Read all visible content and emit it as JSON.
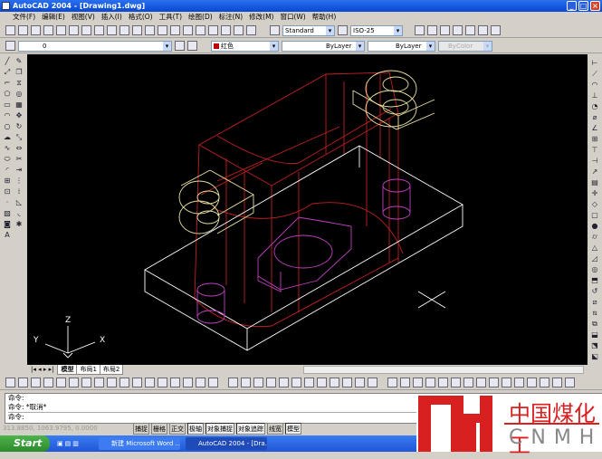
{
  "window": {
    "title": "AutoCAD 2004 - [Drawing1.dwg]"
  },
  "menu": [
    "文件(F)",
    "编辑(E)",
    "视图(V)",
    "插入(I)",
    "格式(O)",
    "工具(T)",
    "绘图(D)",
    "标注(N)",
    "修改(M)",
    "窗口(W)",
    "帮助(H)"
  ],
  "toolbar": {
    "text_style": "Standard",
    "dim_style": "ISO-25",
    "layer": "0",
    "color": "红色",
    "linetype": "ByLayer",
    "lineweight": "ByLayer",
    "plotstyle": "ByColor"
  },
  "colors": {
    "color_swatch": "#c00000",
    "plate": "#ffffff",
    "body": "#c02020",
    "bosses": "#e8e0a0",
    "holes": "#c040c0"
  },
  "ucs": {
    "z": "Z",
    "y": "Y",
    "x": "X"
  },
  "tabs": [
    "模型",
    "布局1",
    "布局2"
  ],
  "command": {
    "lines": [
      "命令:",
      "命令: *取消*",
      "命令:"
    ]
  },
  "status": {
    "coords": "313.8850, 1063.9795, 0.0000",
    "buttons": [
      {
        "label": "捕捉",
        "on": false
      },
      {
        "label": "栅格",
        "on": false
      },
      {
        "label": "正交",
        "on": false
      },
      {
        "label": "极轴",
        "on": true
      },
      {
        "label": "对象捕捉",
        "on": true
      },
      {
        "label": "对象追踪",
        "on": true
      },
      {
        "label": "线宽",
        "on": false
      },
      {
        "label": "模型",
        "on": true
      }
    ]
  },
  "taskbar": {
    "start": "Start",
    "tasks": [
      "新建 Microsoft Word ...",
      "AutoCAD 2004 - [Dra..."
    ]
  },
  "logo": {
    "cn": "中国煤化工",
    "en": "CNMHG"
  }
}
